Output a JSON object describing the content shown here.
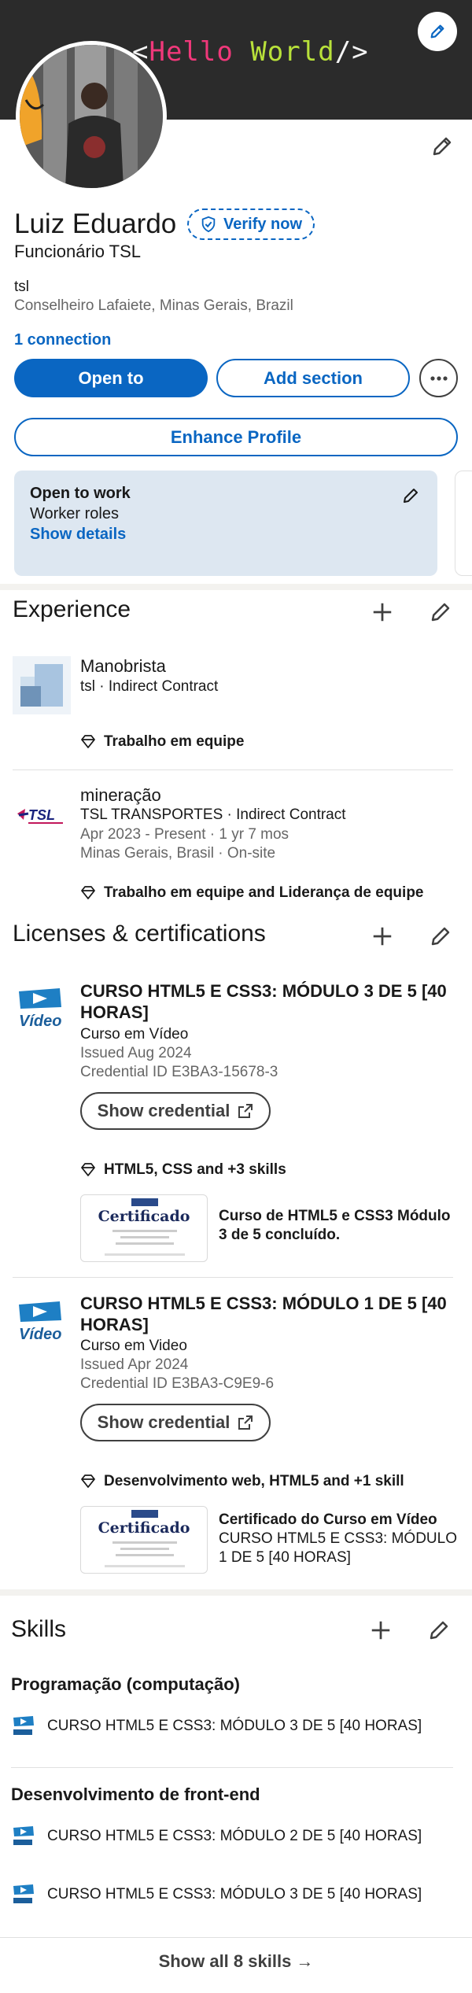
{
  "banner": {
    "code_open": "<",
    "code_hello": "Hello",
    "code_world": "World",
    "code_close": "/>"
  },
  "profile": {
    "name": "Luiz Eduardo",
    "verify_label": "Verify now",
    "headline": "Funcionário TSL",
    "company": "tsl",
    "location": "Conselheiro Lafaiete, Minas Gerais, Brazil",
    "connections": "1 connection"
  },
  "actions": {
    "open_to": "Open to",
    "add_section": "Add section",
    "enhance": "Enhance Profile"
  },
  "open_to_work": {
    "title": "Open to work",
    "roles": "Worker roles",
    "link": "Show details"
  },
  "experience": {
    "title": "Experience",
    "items": [
      {
        "title": "Manobrista",
        "subtitle": "tsl · Indirect Contract",
        "skills": "Trabalho em equipe"
      },
      {
        "title": "mineração",
        "subtitle": "TSL TRANSPORTES · Indirect Contract",
        "dates": "Apr 2023 - Present · 1 yr 7 mos",
        "place": "Minas Gerais, Brasil · On-site",
        "skills": "Trabalho em equipe and Liderança de equipe",
        "logo_text": "TSL"
      }
    ]
  },
  "licenses": {
    "title": "Licenses & certifications",
    "items": [
      {
        "title": "CURSO HTML5 E CSS3: MÓDULO 3 DE 5 [40 HORAS]",
        "issuer": "Curso em Vídeo",
        "issued": "Issued Aug 2024",
        "credential": "Credential ID E3BA3-15678-3",
        "button": "Show credential",
        "skills": "HTML5, CSS and +3 skills",
        "media_title": "Curso de HTML5 e CSS3 Módulo 3 de 5 concluído.",
        "media_sub": "",
        "thumb_word": "Certificado",
        "logo_text": "Vídeo"
      },
      {
        "title": "CURSO HTML5 E CSS3: MÓDULO 1 DE 5 [40 HORAS]",
        "issuer": "Curso em Video",
        "issued": "Issued Apr 2024",
        "credential": "Credential ID E3BA3-C9E9-6",
        "button": "Show credential",
        "skills": "Desenvolvimento web, HTML5 and +1 skill",
        "media_title": "Certificado do Curso em Vídeo",
        "media_sub": "CURSO HTML5 E CSS3: MÓDULO 1 DE 5 [40 HORAS]",
        "thumb_word": "Certificado",
        "logo_text": "Vídeo"
      }
    ]
  },
  "skills": {
    "title": "Skills",
    "groups": [
      {
        "name": "Programação (computação)",
        "certs": [
          "CURSO HTML5 E CSS3: MÓDULO 3 DE 5 [40 HORAS]"
        ]
      },
      {
        "name": "Desenvolvimento de front-end",
        "certs": [
          "CURSO HTML5 E CSS3: MÓDULO 2 DE 5 [40 HORAS]",
          "CURSO HTML5 E CSS3: MÓDULO 3 DE 5 [40 HORAS]"
        ]
      }
    ],
    "show_all": "Show all 8 skills →"
  },
  "colors": {
    "accent": "#0a66c2",
    "banner": "#2b2b2b",
    "card": "#dde7f1"
  },
  "icons": [
    "pencil-icon",
    "shield-check-icon",
    "more-icon",
    "plus-icon",
    "diamond-icon",
    "external-link-icon",
    "video-logo-icon"
  ]
}
